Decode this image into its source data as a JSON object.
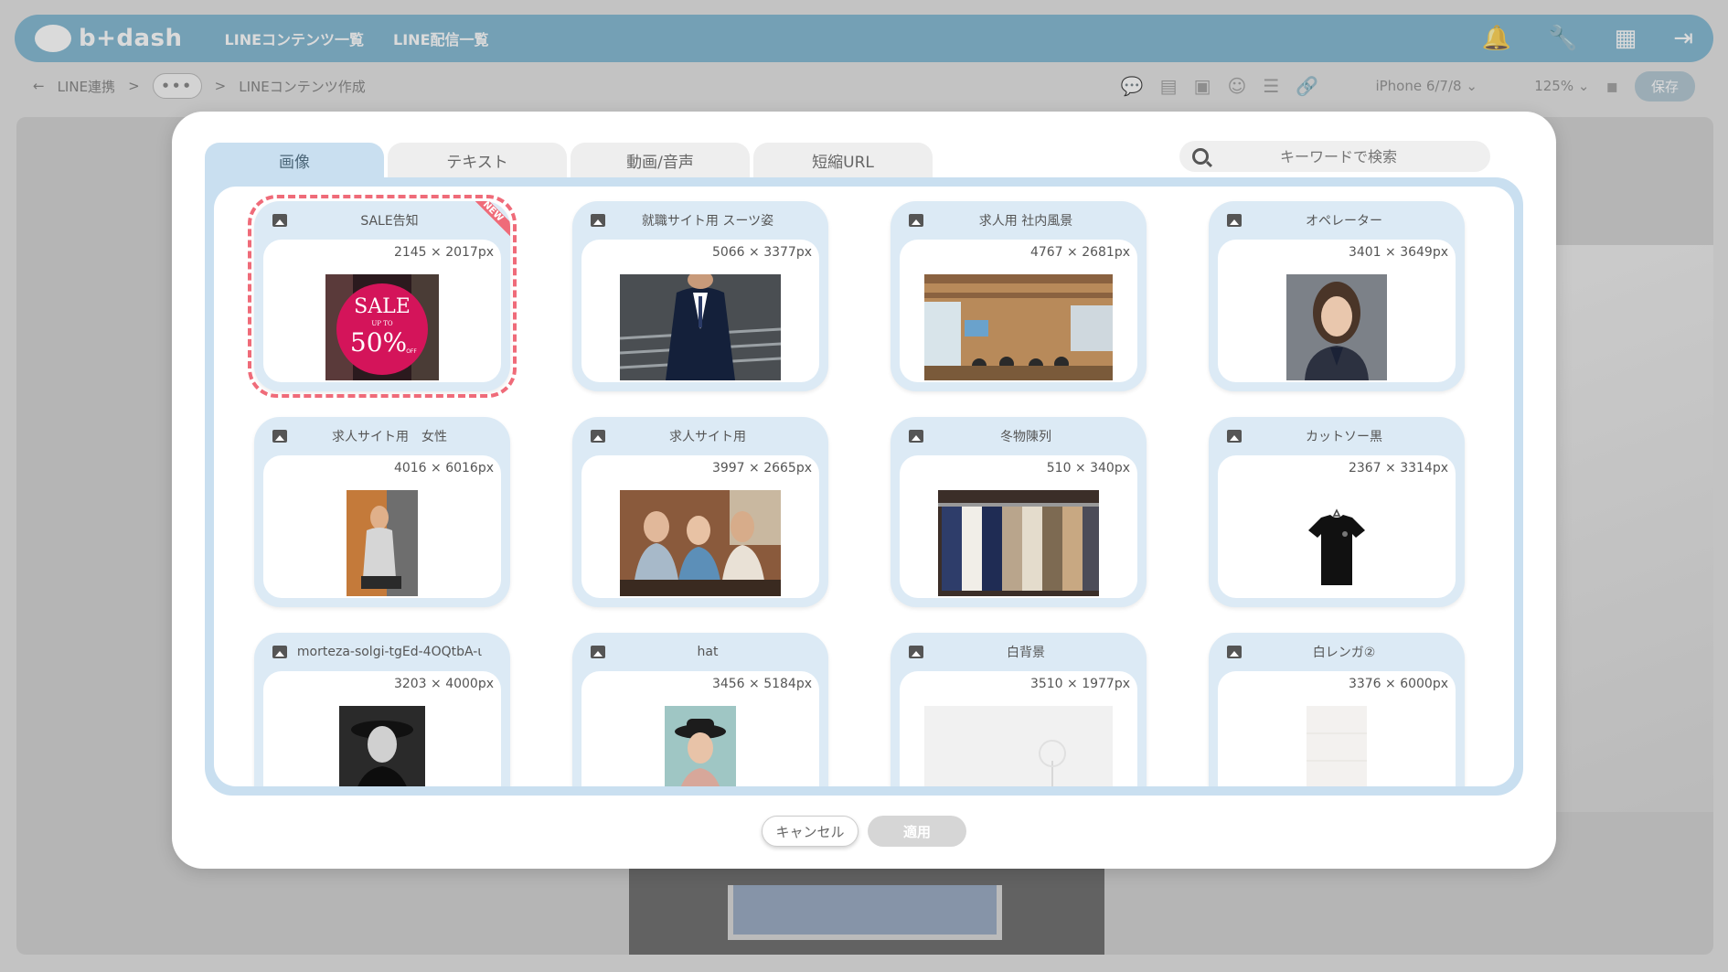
{
  "app": {
    "logo_text": "b+dash",
    "nav": [
      "LINEコンテンツ一覧",
      "LINE配信一覧"
    ],
    "breadcrumb": {
      "back": "←",
      "root": "LINE連携",
      "sep1": ">",
      "more": "•••",
      "sep2": ">",
      "current": "LINEコンテンツ作成"
    },
    "device": "iPhone 6/7/8",
    "zoom": "125%",
    "save_label": "保存"
  },
  "modal": {
    "tabs": [
      {
        "label": "画像",
        "active": true
      },
      {
        "label": "テキスト",
        "active": false
      },
      {
        "label": "動画/音声",
        "active": false
      },
      {
        "label": "短縮URL",
        "active": false
      }
    ],
    "search_placeholder": "キーワードで検索",
    "new_badge": "NEW",
    "images": [
      {
        "title": "SALE告知",
        "size": "2145 × 2017px",
        "selected": true,
        "new": true
      },
      {
        "title": "就職サイト用 スーツ姿",
        "size": "5066 × 3377px"
      },
      {
        "title": "求人用 社内風景",
        "size": "4767 × 2681px"
      },
      {
        "title": "オペレーター",
        "size": "3401 × 3649px"
      },
      {
        "title": "求人サイト用　女性",
        "size": "4016 × 6016px"
      },
      {
        "title": "求人サイト用",
        "size": "3997 × 2665px"
      },
      {
        "title": "冬物陳列",
        "size": "510 × 340px"
      },
      {
        "title": "カットソー黒",
        "size": "2367 × 3314px"
      },
      {
        "title": "morteza-solgi-tgEd-4OQtbA-ι",
        "size": "3203 × 4000px"
      },
      {
        "title": "hat",
        "size": "3456 × 5184px"
      },
      {
        "title": "白背景",
        "size": "3510 × 1977px"
      },
      {
        "title": "白レンガ②",
        "size": "3376 × 6000px"
      }
    ],
    "sale_text": {
      "main": "SALE",
      "sub": "UP TO",
      "pct": "50%",
      "off": "OFF"
    },
    "cancel_label": "キャンセル",
    "apply_label": "適用"
  },
  "colors": {
    "brand": "#63a6c6",
    "panel": "#c9dff0",
    "selected_border": "#ef6b79"
  }
}
